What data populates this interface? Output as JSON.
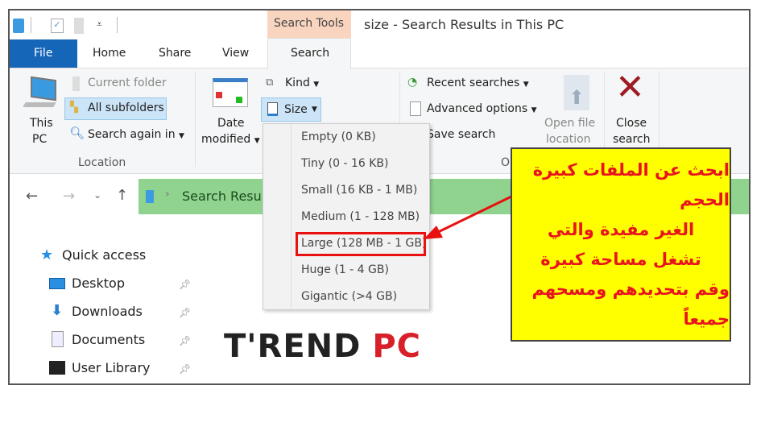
{
  "window": {
    "title": "size - Search Results in This PC",
    "context_tab": "Search Tools"
  },
  "tabs": [
    {
      "label": "File"
    },
    {
      "label": "Home"
    },
    {
      "label": "Share"
    },
    {
      "label": "View"
    },
    {
      "label": "Search"
    }
  ],
  "ribbon": {
    "this_pc": [
      "This",
      "PC"
    ],
    "current_folder": "Current folder",
    "all_subfolders": "All subfolders",
    "search_again": "Search again in",
    "location_group": "Location",
    "date_modified": [
      "Date",
      "modified"
    ],
    "kind": "Kind",
    "size": "Size",
    "recent_searches": "Recent searches",
    "advanced_options": "Advanced options",
    "save_search": "Save search",
    "options_group": "Options",
    "open_file_location": [
      "Open file",
      "location"
    ],
    "close_search": [
      "Close",
      "search"
    ]
  },
  "size_menu": [
    "Empty (0 KB)",
    "Tiny (0 - 16 KB)",
    "Small (16 KB - 1 MB)",
    "Medium (1 - 128 MB)",
    "Large (128 MB - 1 GB)",
    "Huge (1 - 4 GB)",
    "Gigantic (>4 GB)"
  ],
  "address": {
    "path": "Search Results"
  },
  "nav": {
    "quick_access": "Quick access",
    "items": [
      {
        "label": "Desktop"
      },
      {
        "label": "Downloads"
      },
      {
        "label": "Documents"
      },
      {
        "label": "User Library"
      }
    ]
  },
  "annotation": {
    "lines": [
      "ابحث عن الملفات كبيرة الحجم",
      "الغير مفيدة والتي",
      "تشغل مساحة كبيرة",
      "وقم بتحديدهم ومسحهم جميعاً"
    ]
  },
  "logo": {
    "text_dark": "T'REND",
    "text_red": "PC"
  },
  "colors": {
    "file_tab": "#1565b8",
    "context_tab": "#f9d5bf",
    "address_bar": "#8fd38f",
    "highlight": "#e81010",
    "note_bg": "#ffff00"
  }
}
